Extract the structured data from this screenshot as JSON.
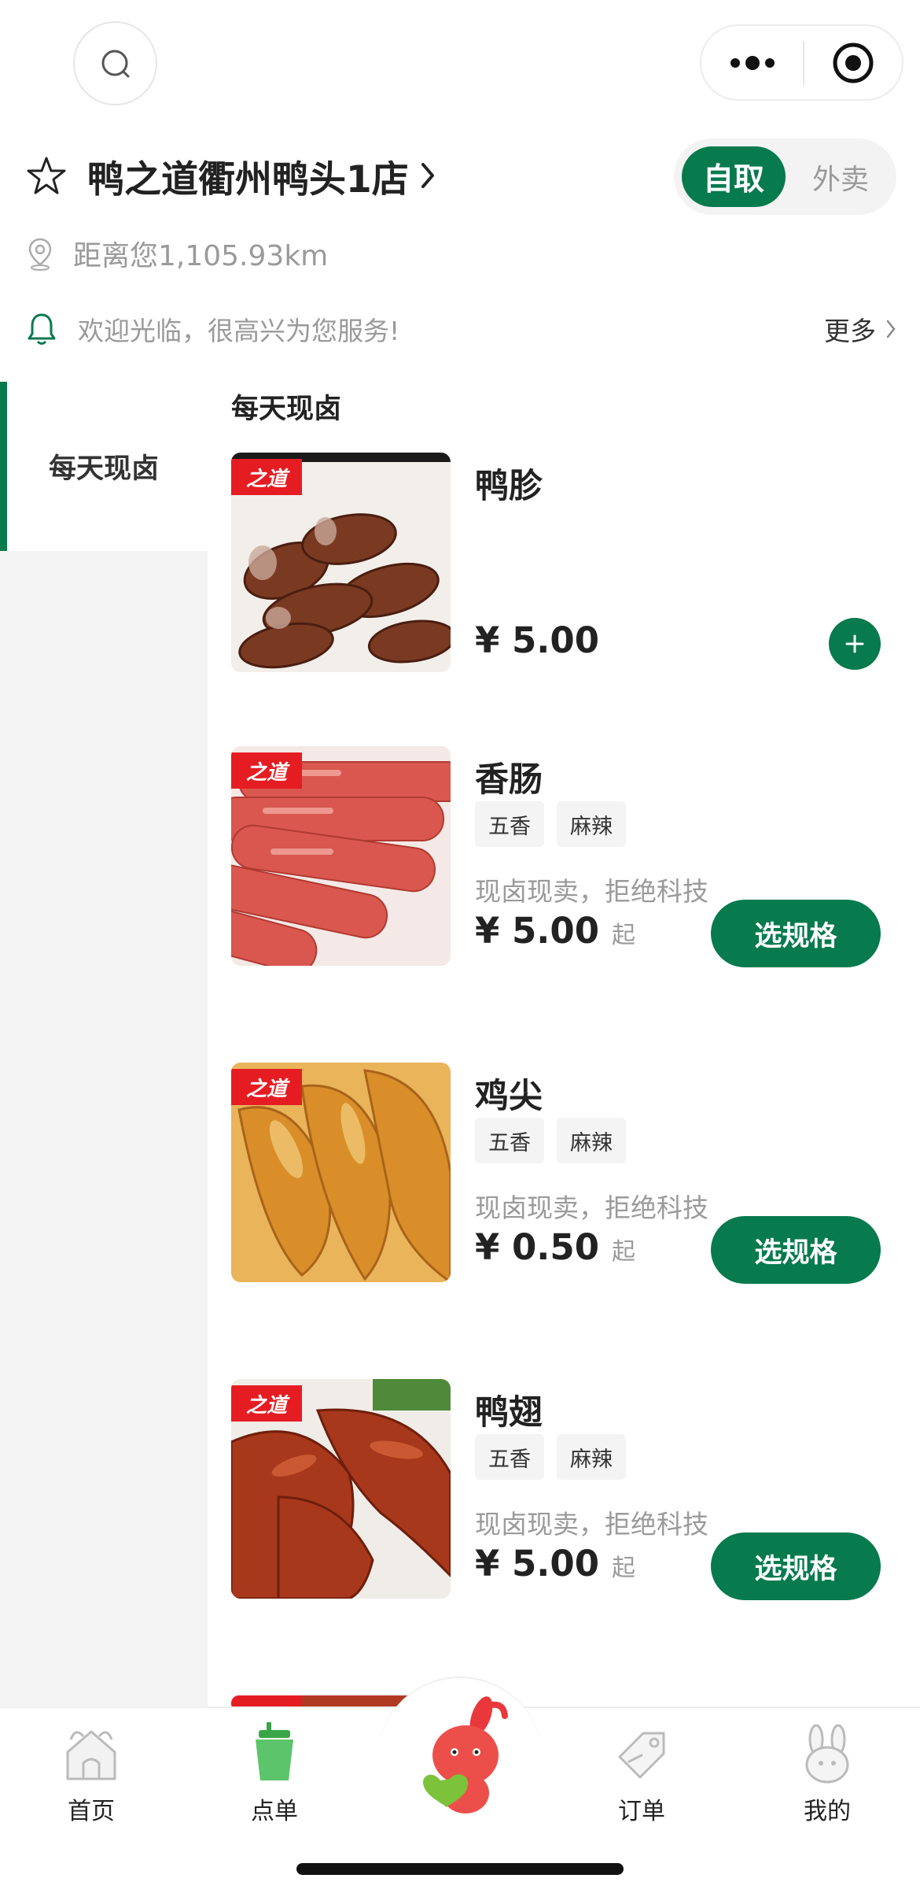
{
  "topbar": {
    "search_icon": "search-icon",
    "more_icon": "more-dots-icon",
    "close_icon": "target-icon"
  },
  "store": {
    "name": "鸭之道衢州鸭头1店",
    "distance": "距离您1,105.93km",
    "notice": "欢迎光临，很高兴为您服务!",
    "more_label": "更多"
  },
  "mode": {
    "pickup": "自取",
    "delivery": "外卖",
    "selected": "自取"
  },
  "sidebar": {
    "categories": [
      "每天现卤"
    ],
    "active": "每天现卤"
  },
  "menu": {
    "section_title": "每天现卤",
    "brand_tag": "之道",
    "items": [
      {
        "name": "鸭胗",
        "price": "¥ 5.00",
        "price_suffix": "",
        "tags": [],
        "desc": "",
        "action": "add"
      },
      {
        "name": "香肠",
        "price": "¥ 5.00",
        "price_suffix": "起",
        "tags": [
          "五香",
          "麻辣"
        ],
        "desc": "现卤现卖，拒绝科技",
        "action": "选规格"
      },
      {
        "name": "鸡尖",
        "price": "¥ 0.50",
        "price_suffix": "起",
        "tags": [
          "五香",
          "麻辣"
        ],
        "desc": "现卤现卖，拒绝科技",
        "action": "选规格"
      },
      {
        "name": "鸭翅",
        "price": "¥ 5.00",
        "price_suffix": "起",
        "tags": [
          "五香",
          "麻辣"
        ],
        "desc": "现卤现卖，拒绝科技",
        "action": "选规格"
      }
    ]
  },
  "tabbar": {
    "items": [
      {
        "label": "首页",
        "icon": "home-icon"
      },
      {
        "label": "点单",
        "icon": "order-cup-icon"
      },
      {
        "label": "",
        "icon": "mascot-rabbit-icon"
      },
      {
        "label": "订单",
        "icon": "tag-icon"
      },
      {
        "label": "我的",
        "icon": "rabbit-profile-icon"
      }
    ]
  },
  "colors": {
    "accent": "#077a4e",
    "brand_red": "#e51d23",
    "muted": "#9a9a9a"
  }
}
